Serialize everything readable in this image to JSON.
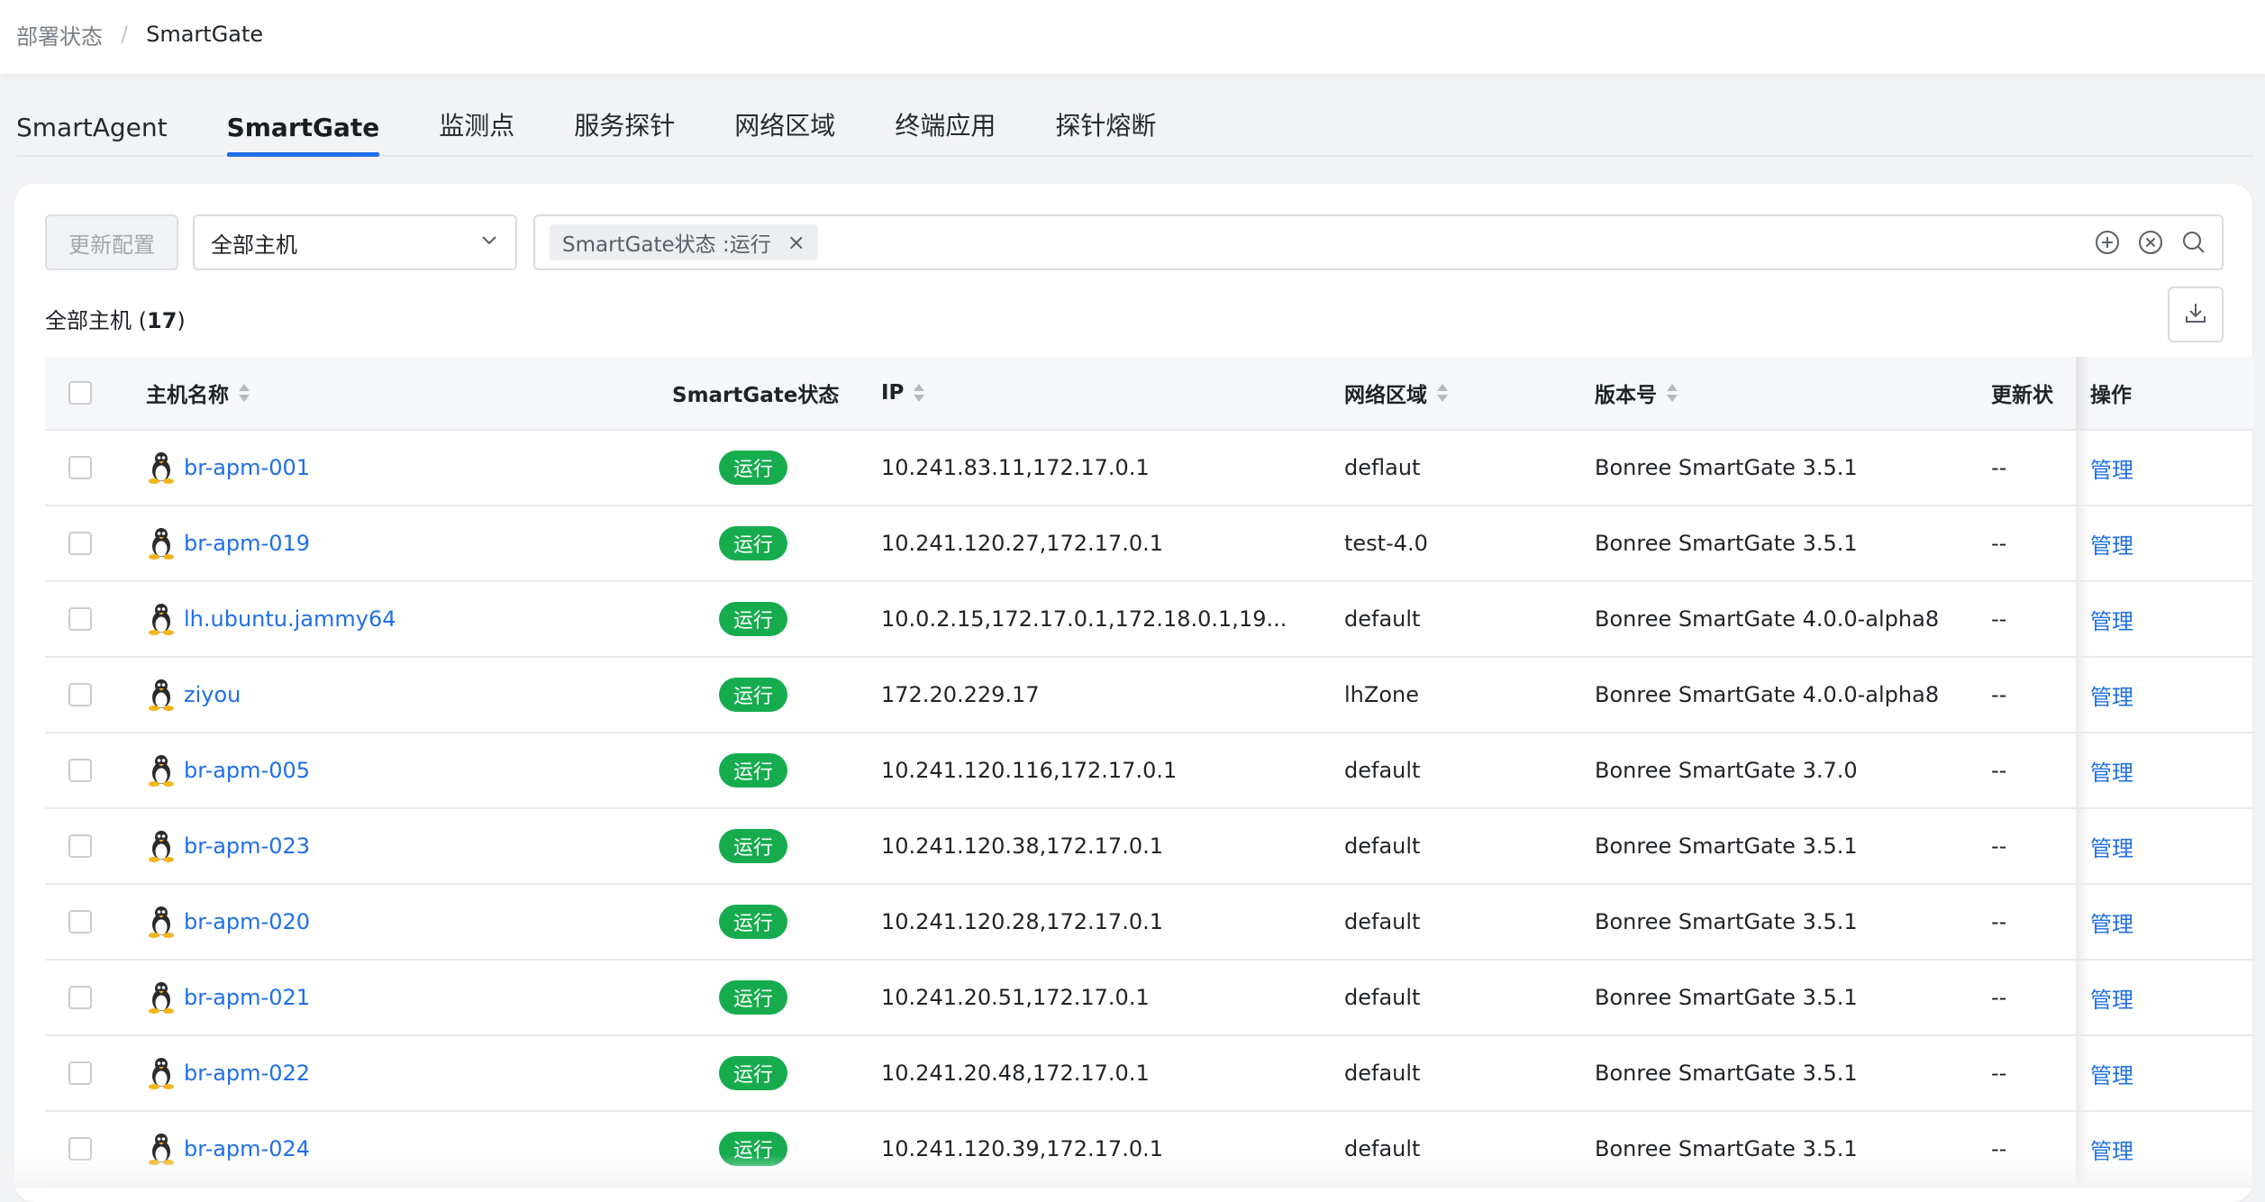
{
  "breadcrumb": {
    "parent": "部署状态",
    "separator": "/",
    "current": "SmartGate"
  },
  "tabs": [
    {
      "label": "SmartAgent",
      "active": false
    },
    {
      "label": "SmartGate",
      "active": true
    },
    {
      "label": "监测点",
      "active": false
    },
    {
      "label": "服务探针",
      "active": false
    },
    {
      "label": "网络区域",
      "active": false
    },
    {
      "label": "终端应用",
      "active": false
    },
    {
      "label": "探针熔断",
      "active": false
    }
  ],
  "toolbar": {
    "update_button": "更新配置",
    "host_select": "全部主机",
    "filter_chip": "SmartGate状态 :运行"
  },
  "count": {
    "label": "全部主机",
    "value": "17"
  },
  "columns": {
    "name": "主机名称",
    "status": "SmartGate状态",
    "ip": "IP",
    "zone": "网络区域",
    "version": "版本号",
    "update": "更新状",
    "ops": "操作"
  },
  "rows": [
    {
      "name": "br-apm-001",
      "status": "运行",
      "ip": "10.241.83.11,172.17.0.1",
      "zone": "deflaut",
      "version": "Bonree SmartGate 3.5.1",
      "update": "--",
      "op": "管理"
    },
    {
      "name": "br-apm-019",
      "status": "运行",
      "ip": "10.241.120.27,172.17.0.1",
      "zone": "test-4.0",
      "version": "Bonree SmartGate 3.5.1",
      "update": "--",
      "op": "管理"
    },
    {
      "name": "lh.ubuntu.jammy64",
      "status": "运行",
      "ip": "10.0.2.15,172.17.0.1,172.18.0.1,19...",
      "zone": "default",
      "version": "Bonree SmartGate 4.0.0-alpha8",
      "update": "--",
      "op": "管理"
    },
    {
      "name": "ziyou",
      "status": "运行",
      "ip": "172.20.229.17",
      "zone": "lhZone",
      "version": "Bonree SmartGate 4.0.0-alpha8",
      "update": "--",
      "op": "管理"
    },
    {
      "name": "br-apm-005",
      "status": "运行",
      "ip": "10.241.120.116,172.17.0.1",
      "zone": "default",
      "version": "Bonree SmartGate 3.7.0",
      "update": "--",
      "op": "管理"
    },
    {
      "name": "br-apm-023",
      "status": "运行",
      "ip": "10.241.120.38,172.17.0.1",
      "zone": "default",
      "version": "Bonree SmartGate 3.5.1",
      "update": "--",
      "op": "管理"
    },
    {
      "name": "br-apm-020",
      "status": "运行",
      "ip": "10.241.120.28,172.17.0.1",
      "zone": "default",
      "version": "Bonree SmartGate 3.5.1",
      "update": "--",
      "op": "管理"
    },
    {
      "name": "br-apm-021",
      "status": "运行",
      "ip": "10.241.20.51,172.17.0.1",
      "zone": "default",
      "version": "Bonree SmartGate 3.5.1",
      "update": "--",
      "op": "管理"
    },
    {
      "name": "br-apm-022",
      "status": "运行",
      "ip": "10.241.20.48,172.17.0.1",
      "zone": "default",
      "version": "Bonree SmartGate 3.5.1",
      "update": "--",
      "op": "管理"
    },
    {
      "name": "br-apm-024",
      "status": "运行",
      "ip": "10.241.120.39,172.17.0.1",
      "zone": "default",
      "version": "Bonree SmartGate 3.5.1",
      "update": "--",
      "op": "管理"
    }
  ],
  "colors": {
    "accent": "#1f6fe6",
    "running": "#16ac4e",
    "link": "#1f6fe6"
  }
}
